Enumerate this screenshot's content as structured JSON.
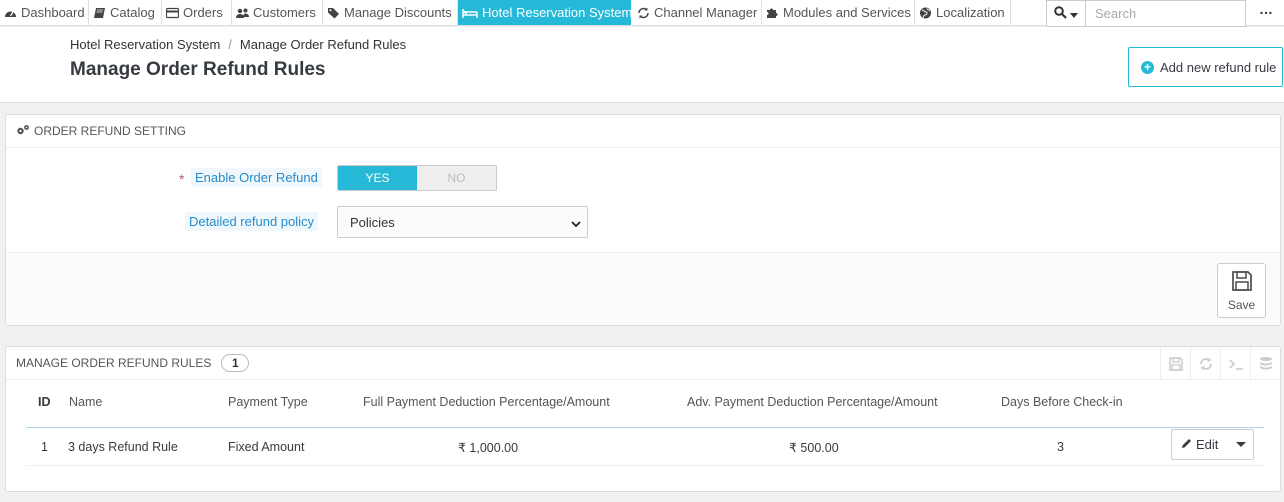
{
  "nav": {
    "items": [
      {
        "label": "Dashboard",
        "icon": "dashboard-icon"
      },
      {
        "label": "Catalog",
        "icon": "book-icon"
      },
      {
        "label": "Orders",
        "icon": "credit-card-icon"
      },
      {
        "label": "Customers",
        "icon": "users-icon"
      },
      {
        "label": "Manage Discounts",
        "icon": "tag-icon"
      },
      {
        "label": "Hotel Reservation System",
        "icon": "bed-icon",
        "active": true
      },
      {
        "label": "Channel Manager",
        "icon": "refresh-icon"
      },
      {
        "label": "Modules and Services",
        "icon": "puzzle-icon"
      },
      {
        "label": "Localization",
        "icon": "globe-icon"
      }
    ],
    "search_placeholder": "Search"
  },
  "header": {
    "breadcrumb": [
      "Hotel Reservation System",
      "Manage Order Refund Rules"
    ],
    "breadcrumb_sep": "/",
    "title": "Manage Order Refund Rules",
    "add_button": "Add new refund rule"
  },
  "settings": {
    "heading": "ORDER REFUND SETTING",
    "enable_label": "Enable Order Refund",
    "required_mark": "*",
    "toggle_yes": "YES",
    "toggle_no": "NO",
    "toggle_value": "YES",
    "policy_label": "Detailed refund policy",
    "policy_value": "Policies",
    "save_label": "Save"
  },
  "rules": {
    "heading": "MANAGE ORDER REFUND RULES",
    "count": "1",
    "columns": [
      "ID",
      "Name",
      "Payment Type",
      "Full Payment Deduction Percentage/Amount",
      "Adv. Payment Deduction Percentage/Amount",
      "Days Before Check-in"
    ],
    "rows": [
      {
        "id": "1",
        "name": "3 days Refund Rule",
        "payment_type": "Fixed Amount",
        "full_deduction": "₹ 1,000.00",
        "adv_deduction": "₹ 500.00",
        "days": "3"
      }
    ],
    "edit_label": "Edit"
  },
  "colors": {
    "accent": "#25b9d7",
    "label_blue": "#268ccd"
  }
}
